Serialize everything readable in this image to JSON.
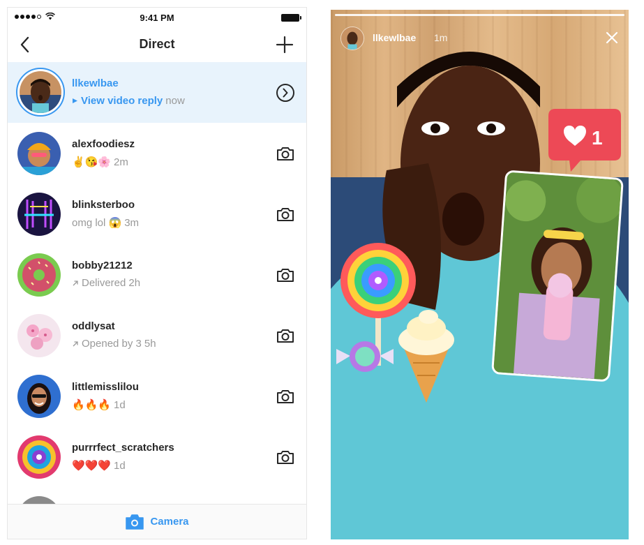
{
  "status_bar": {
    "time": "9:41 PM"
  },
  "nav": {
    "title": "Direct"
  },
  "threads": [
    {
      "username": "llkewlbae",
      "sub_link": "View video reply",
      "sub_time": "now",
      "action": "arrow"
    },
    {
      "username": "alexfoodiesz",
      "sub_text": "✌️😘🌸",
      "sub_time": "2m",
      "action": "camera"
    },
    {
      "username": "blinksterboo",
      "sub_text": "omg lol 😱",
      "sub_time": "3m",
      "action": "camera"
    },
    {
      "username": "bobby21212",
      "sub_text": "Delivered",
      "sub_time": "2h",
      "action": "camera"
    },
    {
      "username": "oddlysat",
      "sub_text": "Opened by 3",
      "sub_time": "5h",
      "action": "camera"
    },
    {
      "username": "littlemisslilou",
      "sub_text": "🔥🔥🔥",
      "sub_time": "1d",
      "action": "camera"
    },
    {
      "username": "purrrfect_scratchers",
      "sub_text": "❤️❤️❤️",
      "sub_time": "1d",
      "action": "camera"
    }
  ],
  "bottom_bar": {
    "label": "Camera"
  },
  "story": {
    "username": "llkewlbae",
    "time": "1m",
    "like_count": "1"
  },
  "colors": {
    "accent": "#3897f0",
    "highlight_bg": "#e8f3fc",
    "like_red": "#ed4956"
  }
}
